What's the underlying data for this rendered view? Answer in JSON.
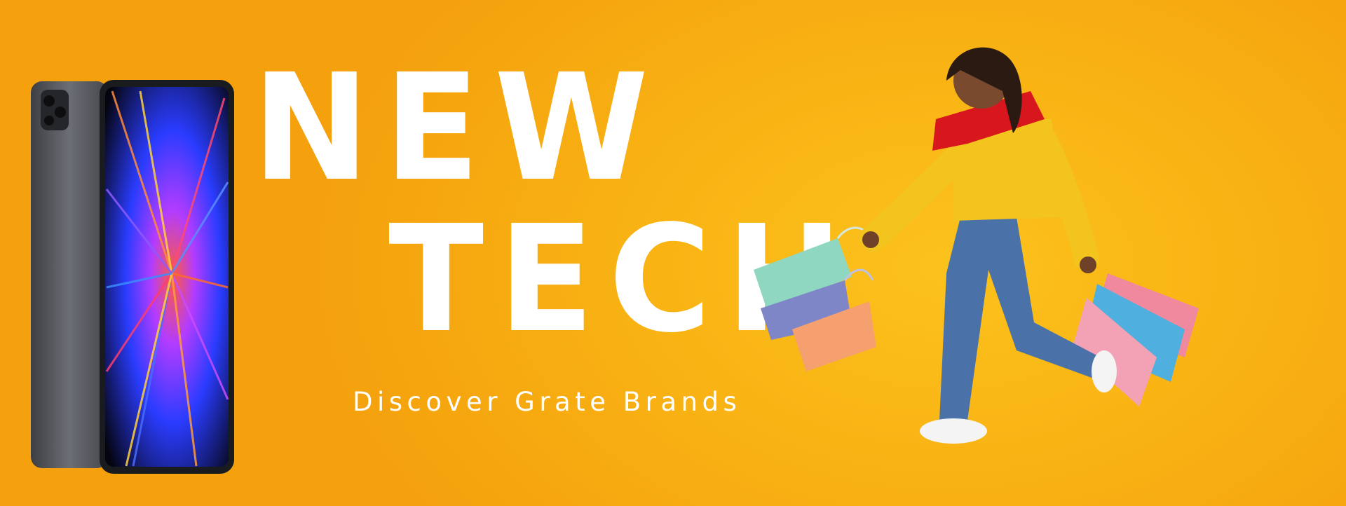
{
  "banner": {
    "headline_line1": "NEW",
    "headline_line2": "TECH",
    "tagline": "Discover Grate Brands"
  },
  "colors": {
    "background": "#f9b414",
    "headline": "#ffffff",
    "jacket": "#f3c41e",
    "scarf": "#d8161d"
  },
  "images": {
    "product": "tablet-photo",
    "person": "shopper-with-bags-photo"
  }
}
